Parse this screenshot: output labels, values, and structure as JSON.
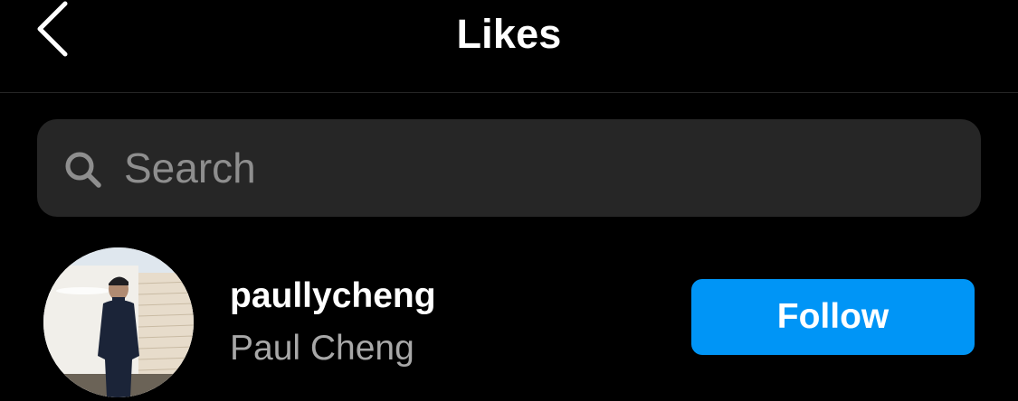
{
  "header": {
    "title": "Likes",
    "back_icon": "chevron-left-icon"
  },
  "search": {
    "placeholder": "Search",
    "value": "",
    "icon": "search-icon"
  },
  "likes": [
    {
      "username": "paullycheng",
      "full_name": "Paul Cheng",
      "follow_label": "Follow"
    }
  ],
  "colors": {
    "background": "#000000",
    "search_background": "#262626",
    "follow_button": "#0095f6",
    "secondary_text": "#a8a8a8",
    "placeholder_text": "#8e8e8e"
  }
}
